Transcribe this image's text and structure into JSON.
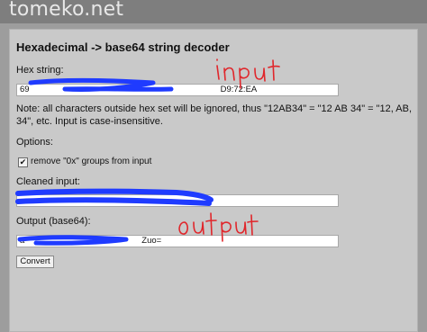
{
  "site": {
    "title": "tomeko.net"
  },
  "form": {
    "title": "Hexadecimal -> base64 string decoder",
    "hex_label": "Hex string:",
    "hex_value_prefix": "69",
    "hex_value_suffix": "D9:72:EA",
    "note": "Note: all characters outside hex set will be ignored, thus \"12AB34\" = \"12 AB 34\" = \"12, AB, 34\", etc. Input is case-insensitive.",
    "options_label": "Options:",
    "checkbox_label": "remove \"0x\" groups from input",
    "checkbox_checked": true,
    "cleaned_label": "Cleaned input:",
    "output_label": "Output (base64):",
    "output_value_prefix": "a",
    "output_value_suffix": "Zuo=",
    "convert_label": "Convert"
  },
  "annotations": {
    "input_text": "input",
    "output_text": "output",
    "ink_color": "#e0262b",
    "redaction_color": "#1f3bff"
  },
  "colors": {
    "page_background": "#9d9d9d",
    "panel_background": "#c9c9c9",
    "topbar": "#7e7e7e"
  }
}
